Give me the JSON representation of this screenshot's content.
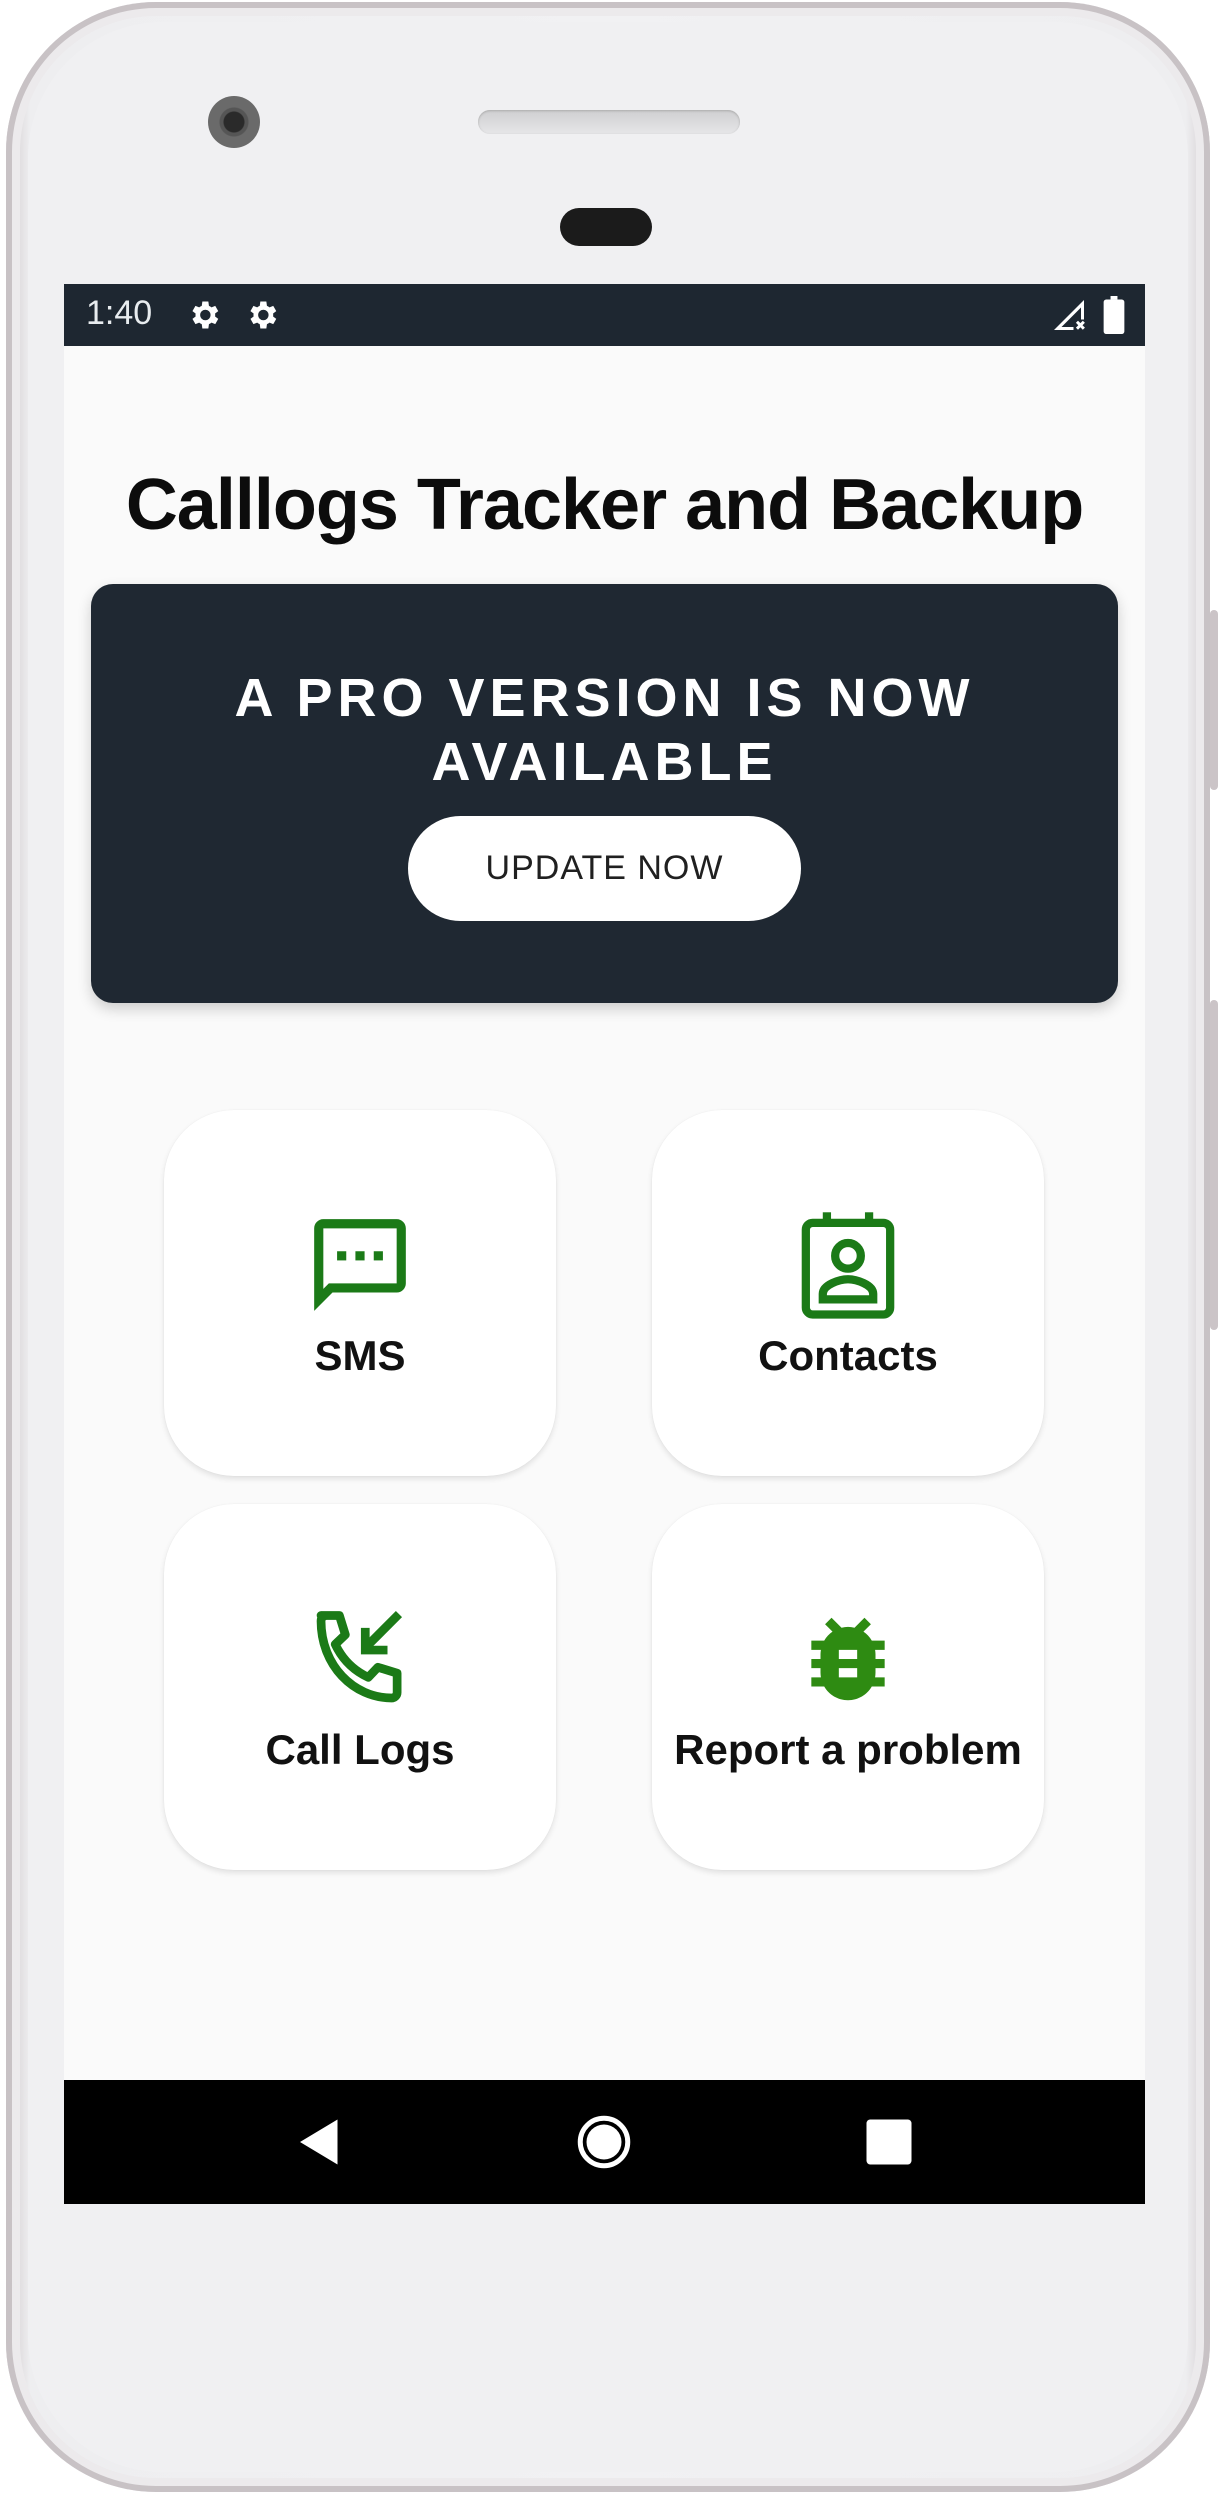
{
  "status_bar": {
    "time": "1:40"
  },
  "app": {
    "title": "Calllogs Tracker and Backup"
  },
  "promo": {
    "line1": "A PRO VERSION IS NOW",
    "line2": "AVAILABLE",
    "button_label": "UPDATE NOW"
  },
  "tiles": [
    {
      "label": "SMS",
      "icon": "sms-icon"
    },
    {
      "label": "Contacts",
      "icon": "contacts-icon"
    },
    {
      "label": "Call Logs",
      "icon": "call-logs-icon"
    },
    {
      "label": "Report a problem",
      "icon": "bug-icon"
    }
  ],
  "colors": {
    "accent_green": "#1b7a17",
    "bug_green": "#2e8b12",
    "status_bar": "#1e2731",
    "promo_bg": "#1f2832",
    "nav_bar": "#000000"
  }
}
